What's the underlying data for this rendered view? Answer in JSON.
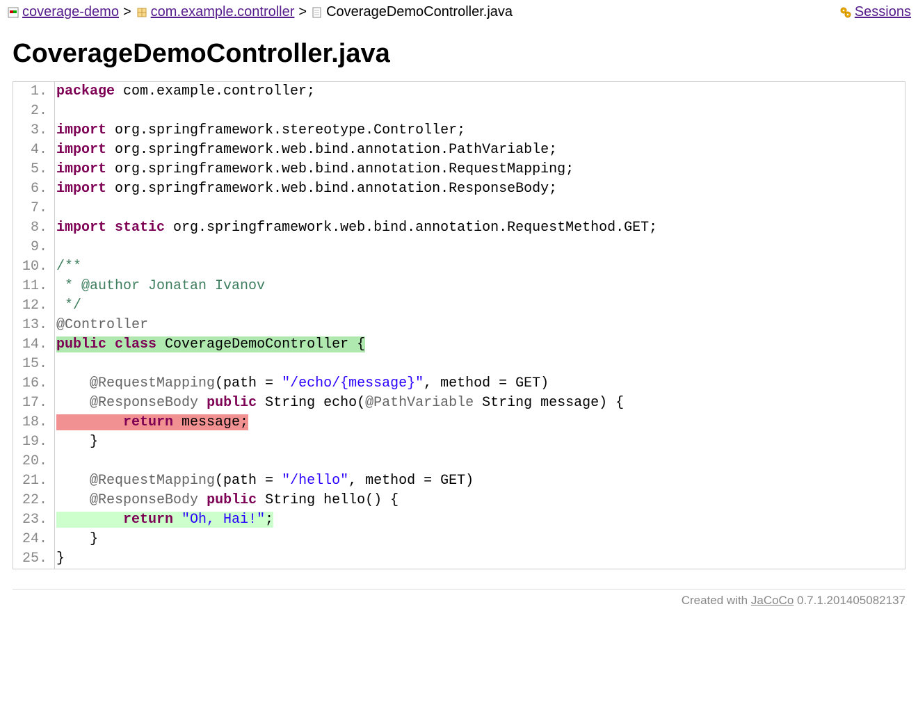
{
  "breadcrumb": {
    "items": [
      {
        "label": "coverage-demo",
        "link": true
      },
      {
        "label": "com.example.controller",
        "link": true
      },
      {
        "label": "CoverageDemoController.java",
        "link": false
      }
    ],
    "sessions_label": "Sessions"
  },
  "page_title": "CoverageDemoController.java",
  "code": {
    "lines": [
      {
        "n": 1,
        "hl": "",
        "tokens": [
          [
            "kw",
            "package"
          ],
          [
            "plain",
            " com.example.controller;"
          ]
        ]
      },
      {
        "n": 2,
        "hl": "",
        "tokens": []
      },
      {
        "n": 3,
        "hl": "",
        "tokens": [
          [
            "kw",
            "import"
          ],
          [
            "plain",
            " org.springframework.stereotype.Controller;"
          ]
        ]
      },
      {
        "n": 4,
        "hl": "",
        "tokens": [
          [
            "kw",
            "import"
          ],
          [
            "plain",
            " org.springframework.web.bind.annotation.PathVariable;"
          ]
        ]
      },
      {
        "n": 5,
        "hl": "",
        "tokens": [
          [
            "kw",
            "import"
          ],
          [
            "plain",
            " org.springframework.web.bind.annotation.RequestMapping;"
          ]
        ]
      },
      {
        "n": 6,
        "hl": "",
        "tokens": [
          [
            "kw",
            "import"
          ],
          [
            "plain",
            " org.springframework.web.bind.annotation.ResponseBody;"
          ]
        ]
      },
      {
        "n": 7,
        "hl": "",
        "tokens": []
      },
      {
        "n": 8,
        "hl": "",
        "tokens": [
          [
            "kw",
            "import"
          ],
          [
            "plain",
            " "
          ],
          [
            "kw",
            "static"
          ],
          [
            "plain",
            " org.springframework.web.bind.annotation.RequestMethod.GET;"
          ]
        ]
      },
      {
        "n": 9,
        "hl": "",
        "tokens": []
      },
      {
        "n": 10,
        "hl": "",
        "tokens": [
          [
            "cmt",
            "/**"
          ]
        ]
      },
      {
        "n": 11,
        "hl": "",
        "tokens": [
          [
            "cmt",
            " * @author Jonatan Ivanov"
          ]
        ]
      },
      {
        "n": 12,
        "hl": "",
        "tokens": [
          [
            "cmt",
            " */"
          ]
        ]
      },
      {
        "n": 13,
        "hl": "",
        "tokens": [
          [
            "ann",
            "@Controller"
          ]
        ]
      },
      {
        "n": 14,
        "hl": "green",
        "tokens": [
          [
            "kw",
            "public"
          ],
          [
            "plain",
            " "
          ],
          [
            "kw",
            "class"
          ],
          [
            "plain",
            " CoverageDemoController {"
          ]
        ]
      },
      {
        "n": 15,
        "hl": "",
        "tokens": []
      },
      {
        "n": 16,
        "hl": "",
        "tokens": [
          [
            "plain",
            "    "
          ],
          [
            "ann",
            "@RequestMapping"
          ],
          [
            "plain",
            "(path = "
          ],
          [
            "str",
            "\"/echo/{message}\""
          ],
          [
            "plain",
            ", method = GET)"
          ]
        ]
      },
      {
        "n": 17,
        "hl": "",
        "tokens": [
          [
            "plain",
            "    "
          ],
          [
            "ann",
            "@ResponseBody"
          ],
          [
            "plain",
            " "
          ],
          [
            "kw",
            "public"
          ],
          [
            "plain",
            " String echo("
          ],
          [
            "ann",
            "@PathVariable"
          ],
          [
            "plain",
            " String message) {"
          ]
        ]
      },
      {
        "n": 18,
        "hl": "red",
        "tokens": [
          [
            "plain",
            "        "
          ],
          [
            "kw",
            "return"
          ],
          [
            "plain",
            " message;"
          ]
        ]
      },
      {
        "n": 19,
        "hl": "",
        "tokens": [
          [
            "plain",
            "    }"
          ]
        ]
      },
      {
        "n": 20,
        "hl": "",
        "tokens": []
      },
      {
        "n": 21,
        "hl": "",
        "tokens": [
          [
            "plain",
            "    "
          ],
          [
            "ann",
            "@RequestMapping"
          ],
          [
            "plain",
            "(path = "
          ],
          [
            "str",
            "\"/hello\""
          ],
          [
            "plain",
            ", method = GET)"
          ]
        ]
      },
      {
        "n": 22,
        "hl": "",
        "tokens": [
          [
            "plain",
            "    "
          ],
          [
            "ann",
            "@ResponseBody"
          ],
          [
            "plain",
            " "
          ],
          [
            "kw",
            "public"
          ],
          [
            "plain",
            " String hello() {"
          ]
        ]
      },
      {
        "n": 23,
        "hl": "light-green",
        "tokens": [
          [
            "plain",
            "        "
          ],
          [
            "kw",
            "return"
          ],
          [
            "plain",
            " "
          ],
          [
            "str",
            "\"Oh, Hai!\""
          ],
          [
            "plain",
            ";"
          ]
        ]
      },
      {
        "n": 24,
        "hl": "",
        "tokens": [
          [
            "plain",
            "    }"
          ]
        ]
      },
      {
        "n": 25,
        "hl": "",
        "tokens": [
          [
            "plain",
            "}"
          ]
        ]
      }
    ]
  },
  "footer": {
    "prefix": "Created with ",
    "link": "JaCoCo",
    "version": " 0.7.1.201405082137"
  }
}
